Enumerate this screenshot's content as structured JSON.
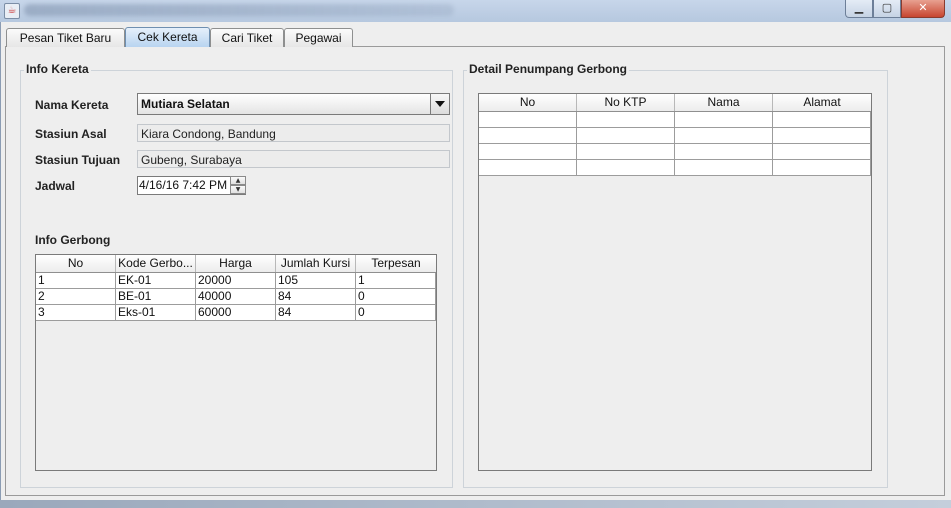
{
  "tabs": [
    {
      "label": "Pesan Tiket Baru",
      "selected": false
    },
    {
      "label": "Cek Kereta",
      "selected": true
    },
    {
      "label": "Cari Tiket",
      "selected": false
    },
    {
      "label": "Pegawai",
      "selected": false
    }
  ],
  "info_kereta": {
    "title": "Info Kereta",
    "nama_kereta_label": "Nama Kereta",
    "nama_kereta_value": "Mutiara Selatan",
    "stasiun_asal_label": "Stasiun Asal",
    "stasiun_asal_value": "Kiara Condong, Bandung",
    "stasiun_tujuan_label": "Stasiun Tujuan",
    "stasiun_tujuan_value": "Gubeng, Surabaya",
    "jadwal_label": "Jadwal",
    "jadwal_value": "4/16/16 7:42 PM"
  },
  "info_gerbong": {
    "title": "Info Gerbong",
    "columns": [
      "No",
      "Kode Gerbo...",
      "Harga",
      "Jumlah Kursi",
      "Terpesan"
    ],
    "rows": [
      [
        "1",
        "EK-01",
        "20000",
        "105",
        "1"
      ],
      [
        "2",
        "BE-01",
        "40000",
        "84",
        "0"
      ],
      [
        "3",
        "Eks-01",
        "60000",
        "84",
        "0"
      ]
    ]
  },
  "detail_penumpang": {
    "title": "Detail Penumpang Gerbong",
    "columns": [
      "No",
      "No KTP",
      "Nama",
      "Alamat"
    ],
    "empty_rows": 4
  },
  "window": {
    "minimize_icon": "minimize-icon",
    "maximize_icon": "maximize-icon",
    "close_icon": "close-icon"
  }
}
